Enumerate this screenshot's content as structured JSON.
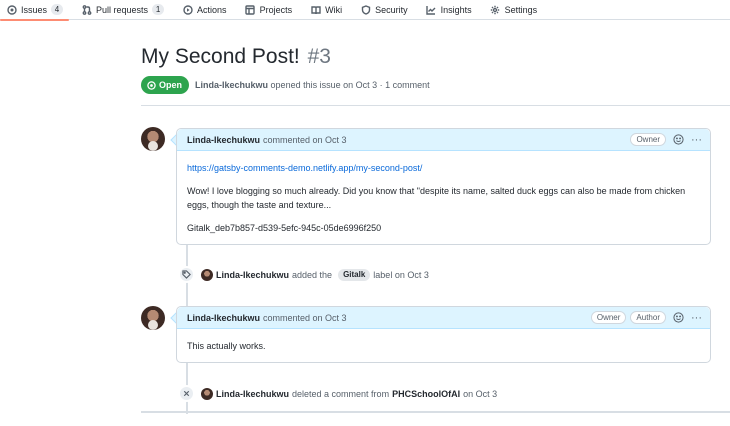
{
  "tabs": [
    {
      "label": "Issues",
      "icon": "issue-opened-icon",
      "count": "4",
      "selected": true
    },
    {
      "label": "Pull requests",
      "icon": "git-pull-request-icon",
      "count": "1"
    },
    {
      "label": "Actions",
      "icon": "play-icon"
    },
    {
      "label": "Projects",
      "icon": "table-icon"
    },
    {
      "label": "Wiki",
      "icon": "book-icon"
    },
    {
      "label": "Security",
      "icon": "shield-icon"
    },
    {
      "label": "Insights",
      "icon": "graph-icon"
    },
    {
      "label": "Settings",
      "icon": "gear-icon"
    }
  ],
  "issue": {
    "title": "My Second Post!",
    "number": "#3",
    "state": "Open",
    "author": "Linda-Ikechukwu",
    "opened_text": "opened this issue on Oct 3 · 1 comment"
  },
  "comments": [
    {
      "author": "Linda-Ikechukwu",
      "meta": "commented on Oct 3",
      "labels": [
        "Owner"
      ],
      "link": "https://gatsby-comments-demo.netlify.app/my-second-post/",
      "paragraph": "Wow! I love blogging so much already. Did you know that \"despite its name, salted duck eggs can also be made from chicken eggs, though the taste and texture...",
      "id_line": "Gitalk_deb7b857-d539-5efc-945c-05de6996f250"
    },
    {
      "author": "Linda-Ikechukwu",
      "meta": "commented on Oct 3",
      "labels": [
        "Owner",
        "Author"
      ],
      "text": "This actually works."
    }
  ],
  "events": [
    {
      "actor": "Linda-Ikechukwu",
      "pre": "added the",
      "label": "Gitalk",
      "post": "label on Oct 3",
      "icon": "tag-icon"
    },
    {
      "actor": "Linda-Ikechukwu",
      "pre": "deleted a comment from",
      "target": "PHCSchoolOfAI",
      "post": "on Oct 3",
      "icon": "x-icon"
    }
  ],
  "colors": {
    "accent_open": "#2da44e",
    "comment_header": "#ddf4ff",
    "link": "#0969da",
    "tab_underline": "#fd8c73"
  }
}
